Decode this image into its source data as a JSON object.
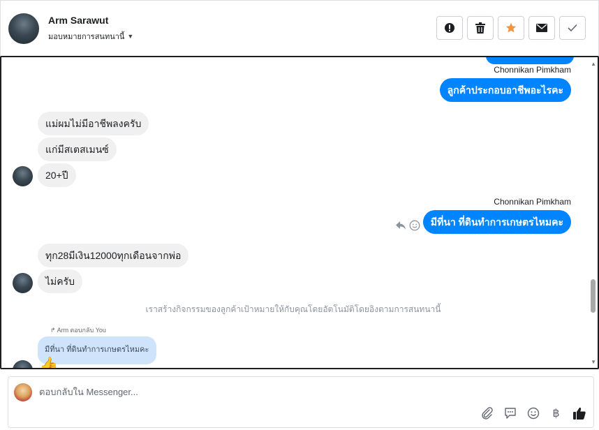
{
  "header": {
    "customer_name": "Arm Sarawut",
    "assign_label": "มอบหมายการสนทนานี้",
    "actions": [
      {
        "name": "spam-button",
        "icon": "exclamation-circle-icon"
      },
      {
        "name": "delete-button",
        "icon": "trash-icon"
      },
      {
        "name": "star-button",
        "icon": "star-icon"
      },
      {
        "name": "mark-unread-button",
        "icon": "envelope-icon"
      },
      {
        "name": "mark-done-button",
        "icon": "check-icon"
      }
    ]
  },
  "conversation": {
    "messages": [
      {
        "from": "page",
        "sender": "Chonnikan Pimkham",
        "text": "ลูกค้าประกอบอาชีพอะไรคะ"
      },
      {
        "from": "customer",
        "text": "แม่ผมไม่มีอาชีพลงครับ"
      },
      {
        "from": "customer",
        "text": "แก่มีสเตสเมนซ์"
      },
      {
        "from": "customer",
        "text": "20+ปี"
      },
      {
        "from": "page",
        "sender": "Chonnikan Pimkham",
        "text": "มีที่นา ที่ดินทำการเกษตรไหมคะ"
      },
      {
        "from": "customer",
        "text": "ทุก28มีเงิน12000ทุกเดือนจากพ่อ"
      },
      {
        "from": "customer",
        "text": "ไม่ครับ"
      }
    ],
    "system_note": "เราสร้างกิจกรรมของลูกค้าเป้าหมายให้กับคุณโดยอัตโนมัติโดยอิงตามการสนทนานี้",
    "reply_note": "Arm ตอบกลับ You",
    "reply_quote": "มีที่นา ที่ดินทำการเกษตรไหมคะ",
    "reaction_emoji": "👍"
  },
  "composer": {
    "placeholder": "ตอบกลับใน Messenger...",
    "tools": [
      "paperclip-icon",
      "saved-reply-icon",
      "emoji-icon",
      "baht-icon",
      "thumbs-up-icon"
    ]
  },
  "colors": {
    "outgoing_bubble": "#0084ff",
    "incoming_bubble": "#f0f0f0",
    "reply_bubble": "#cfe4fb",
    "star": "#f5923e"
  }
}
